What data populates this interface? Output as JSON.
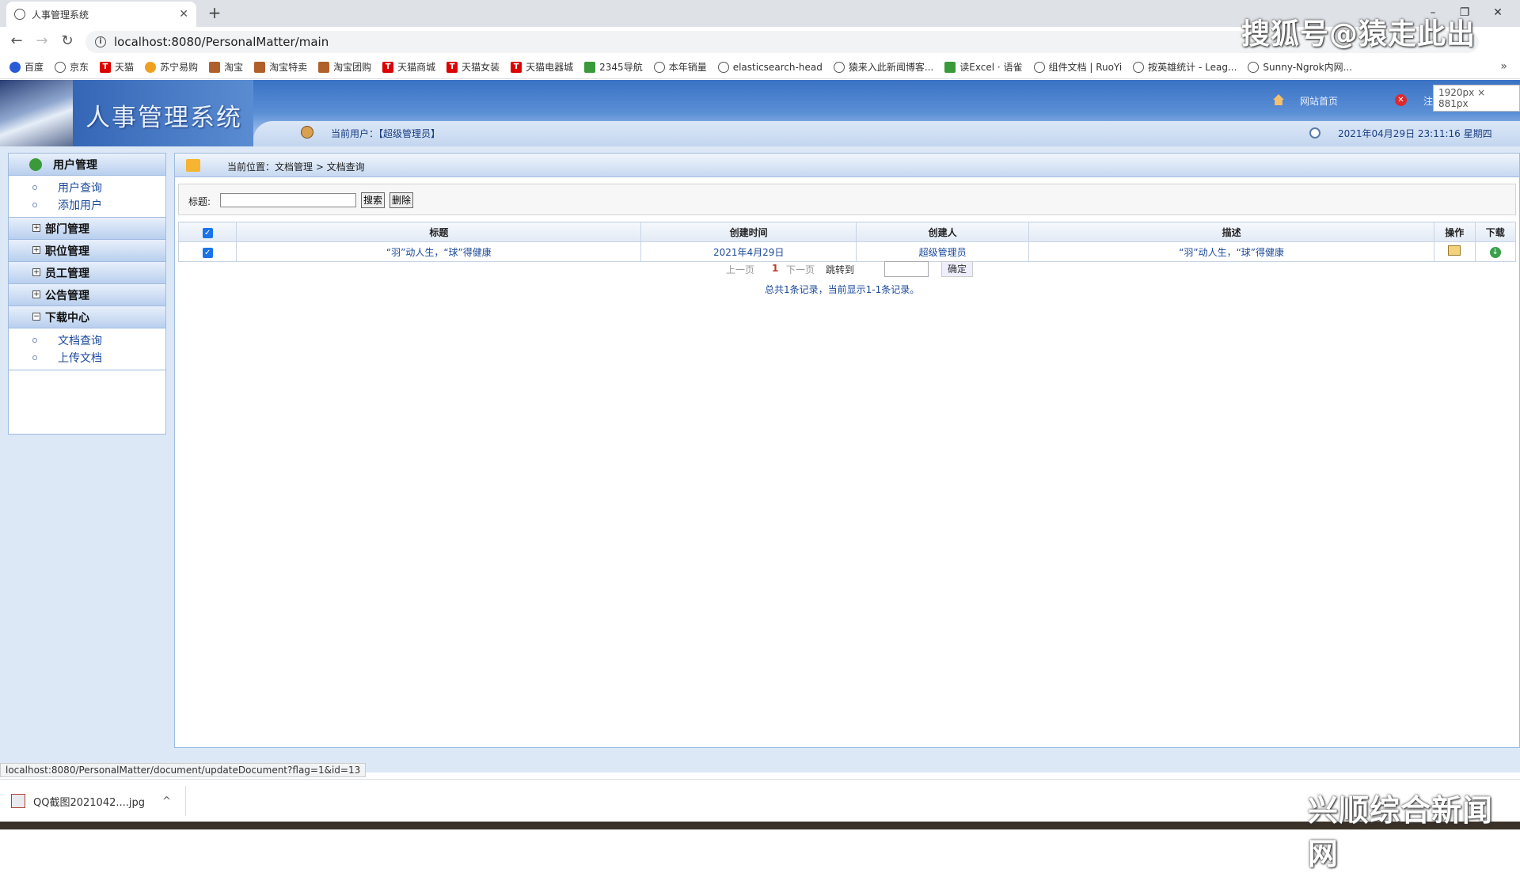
{
  "browser": {
    "tab_title": "人事管理系统",
    "new_tab": "+",
    "url": "localhost:8080/PersonalMatter/main",
    "bookmarks": [
      "百度",
      "京东",
      "天猫",
      "苏宁易购",
      "淘宝",
      "淘宝特卖",
      "淘宝团购",
      "天猫商城",
      "天猫女装",
      "天猫电器城",
      "2345导航",
      "本年销量",
      "elasticsearch-head",
      "猿来入此新闻博客...",
      "读Excel · 语雀",
      "组件文档 | RuoYi",
      "按英雄统计 - Leag...",
      "Sunny-Ngrok内网..."
    ],
    "size_tooltip": "1920px × 881px",
    "status_url": "localhost:8080/PersonalMatter/document/updateDocument?flag=1&id=13",
    "download_file": "QQ截图2021042....jpg"
  },
  "watermarks": {
    "top": "搜狐号@猿走此出",
    "bottom": "兴顺综合新闻网"
  },
  "header": {
    "title": "人事管理系统",
    "current_user": "当前用户：【超级管理员】",
    "home_link": "网站首页",
    "logout_link": "注销退出",
    "datetime": "2021年04月29日 23:11:16 星期四"
  },
  "sidebar": {
    "groups": [
      {
        "label": "用户管理",
        "items": [
          "用户查询",
          "添加用户"
        ]
      },
      {
        "label": "部门管理"
      },
      {
        "label": "职位管理"
      },
      {
        "label": "员工管理"
      },
      {
        "label": "公告管理"
      },
      {
        "label": "下载中心",
        "items": [
          "文档查询",
          "上传文档"
        ]
      }
    ]
  },
  "main": {
    "breadcrumb": "当前位置：文档管理 > 文档查询",
    "search_label": "标题:",
    "search_value": "",
    "search_button": "搜索",
    "delete_button": "删除",
    "table": {
      "headers": [
        "标题",
        "创建时间",
        "创建人",
        "描述",
        "操作",
        "下载"
      ],
      "rows": [
        {
          "checked": true,
          "title": "“羽”动人生，“球”得健康",
          "created": "2021年4月29日",
          "creator": "超级管理员",
          "description": "“羽”动人生，“球”得健康"
        }
      ]
    },
    "pager": {
      "prev": "上一页",
      "current": "1",
      "next": "下一页",
      "jump_label": "跳转到",
      "jump_value": "",
      "confirm": "确定"
    },
    "summary": "总共1条记录，当前显示1-1条记录。"
  }
}
